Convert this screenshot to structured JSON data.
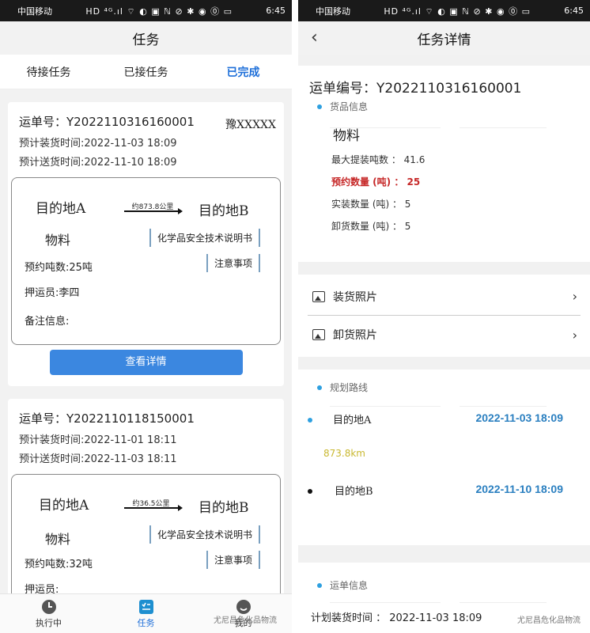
{
  "status": {
    "carrier": "中国移动",
    "time": "6:45",
    "icons": "HD ⁴ᴳ.ıl ⌔ ◐ ▣  ℕ ⊘ ✱ ◉ ⓪ ▭"
  },
  "left": {
    "title": "任务",
    "tabs": [
      "待接任务",
      "已接任务",
      "已完成"
    ],
    "orders": [
      {
        "waybill": "运单号：Y2022110316160001",
        "plate": "豫XXXXX",
        "load_time": "预计装货时间:2022-11-03 18:09",
        "deliver_time": "预计送货时间:2022-11-10 18:09",
        "from": "目的地A",
        "to": "目的地B",
        "distance": "约873.8公里",
        "material": "物料",
        "msds": "化学品安全技术说明书",
        "notes": "注意事项",
        "tonnage": "预约吨数:25吨",
        "escort": "押运员:李四",
        "remark": "备注信息:",
        "detail_button": "查看详情"
      },
      {
        "waybill": "运单号：Y2022110118150001",
        "load_time": "预计装货时间:2022-11-01 18:11",
        "deliver_time": "预计送货时间:2022-11-03 18:11",
        "from": "目的地A",
        "to": "目的地B",
        "distance": "约36.5公里",
        "material": "物料",
        "msds": "化学品安全技术说明书",
        "notes": "注意事项",
        "tonnage": "预约吨数:32吨",
        "escort": "押运员:"
      }
    ],
    "nav": [
      "执行中",
      "任务",
      "我的"
    ],
    "watermark": "尤尼昌危化品物流"
  },
  "right": {
    "title": "任务详情",
    "waybill": "运单编号：Y2022110316160001",
    "goods_section": "货品信息",
    "goods_name": "物料",
    "max_load": "最大提装吨数 ： 41.6",
    "reserved": "预约数量 (吨) ： 25",
    "actual": "实装数量 (吨) ： 5",
    "unload": "卸货数量 (吨) ： 5",
    "load_photo": "装货照片",
    "unload_photo": "卸货照片",
    "route_section": "规划路线",
    "route": {
      "from": "目的地A",
      "from_time": "2022-11-03 18:09",
      "distance": "873.8km",
      "to": "目的地B",
      "to_time": "2022-11-10 18:09"
    },
    "waybill_section": "运单信息",
    "plan_load": "计划装货时间 ：  2022-11-03 18:09",
    "watermark": "尤尼昌危化品物流"
  }
}
